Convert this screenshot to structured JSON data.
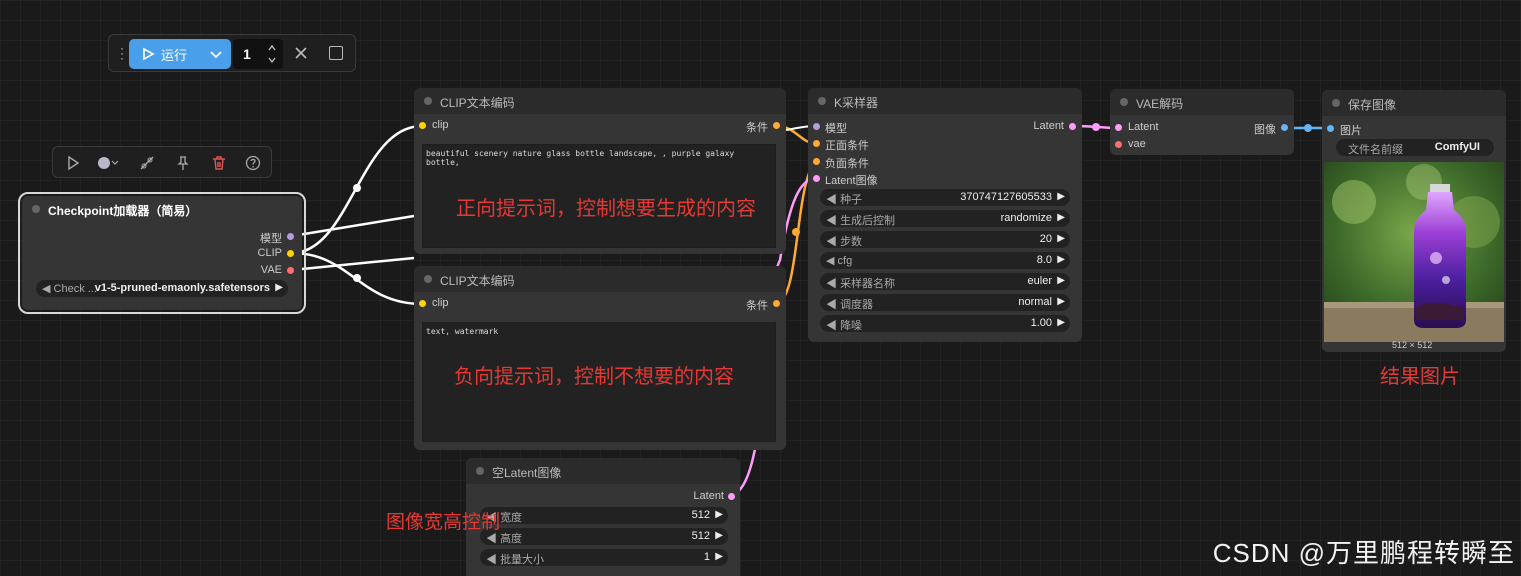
{
  "toolbar": {
    "run_label": "运行",
    "count": "1"
  },
  "nodes": {
    "checkpoint": {
      "title": "Checkpoint加载器（简易）",
      "outputs": [
        "模型",
        "CLIP",
        "VAE"
      ],
      "widget_label": "Check ...",
      "widget_value": "v1-5-pruned-emaonly.safetensors"
    },
    "clip_pos": {
      "title": "CLIP文本编码",
      "input": "clip",
      "output": "条件",
      "text": "beautiful scenery nature glass bottle landscape, , purple galaxy bottle,"
    },
    "clip_neg": {
      "title": "CLIP文本编码",
      "input": "clip",
      "output": "条件",
      "text": "text, watermark"
    },
    "ksampler": {
      "title": "K采样器",
      "inputs": [
        "模型",
        "正面条件",
        "负面条件",
        "Latent图像"
      ],
      "output": "Latent",
      "widgets": [
        {
          "label": "种子",
          "value": "370747127605533"
        },
        {
          "label": "生成后控制",
          "value": "randomize"
        },
        {
          "label": "步数",
          "value": "20"
        },
        {
          "label": "cfg",
          "value": "8.0"
        },
        {
          "label": "采样器名称",
          "value": "euler"
        },
        {
          "label": "调度器",
          "value": "normal"
        },
        {
          "label": "降噪",
          "value": "1.00"
        }
      ]
    },
    "vae": {
      "title": "VAE解码",
      "inputs": [
        "Latent",
        "vae"
      ],
      "output": "图像"
    },
    "save": {
      "title": "保存图像",
      "input": "图片",
      "widget_label": "文件名前缀",
      "widget_value": "ComfyUI",
      "size_caption": "512 × 512"
    },
    "latent": {
      "title": "空Latent图像",
      "output": "Latent",
      "widgets": [
        {
          "label": "宽度",
          "value": "512"
        },
        {
          "label": "高度",
          "value": "512"
        },
        {
          "label": "批量大小",
          "value": "1"
        }
      ]
    }
  },
  "annotations": {
    "positive": "正向提示词，控制想要生成的内容",
    "negative": "负向提示词，控制不想要的内容",
    "size": "图像宽高控制",
    "result": "结果图片"
  },
  "watermark": "CSDN @万里鹏程转瞬至",
  "colors": {
    "model": "#b39ddb",
    "clip": "#ffd500",
    "vae": "#ff6e6e",
    "conditioning": "#ffa931",
    "latent": "#ff9cf9",
    "image": "#64b5f6",
    "run": "#4a9fea",
    "annotation": "#e53935"
  }
}
